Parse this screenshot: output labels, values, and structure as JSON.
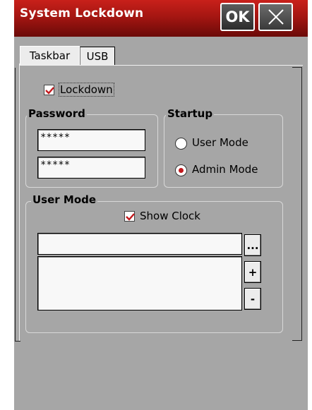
{
  "window": {
    "title": "System Lockdown",
    "ok_label": "OK"
  },
  "tabs": [
    {
      "label": "Taskbar",
      "active": true
    },
    {
      "label": "USB",
      "active": false
    }
  ],
  "lockdown": {
    "label": "Lockdown",
    "checked": true
  },
  "password": {
    "title": "Password",
    "field1": "*****",
    "field2": "*****"
  },
  "startup": {
    "title": "Startup",
    "options": [
      {
        "label": "User Mode",
        "selected": false
      },
      {
        "label": "Admin Mode",
        "selected": true
      }
    ]
  },
  "user_mode": {
    "title": "User Mode",
    "show_clock": {
      "label": "Show Clock",
      "checked": true
    },
    "path_value": "",
    "list_items": [],
    "browse_label": "...",
    "add_label": "+",
    "remove_label": "-"
  },
  "colors": {
    "title_bar": "#a51612",
    "check_mark": "#c2181c",
    "dialog_bg": "#a6a6a6"
  },
  "icons": {
    "close": "close-x-icon",
    "check": "checkmark-icon"
  }
}
